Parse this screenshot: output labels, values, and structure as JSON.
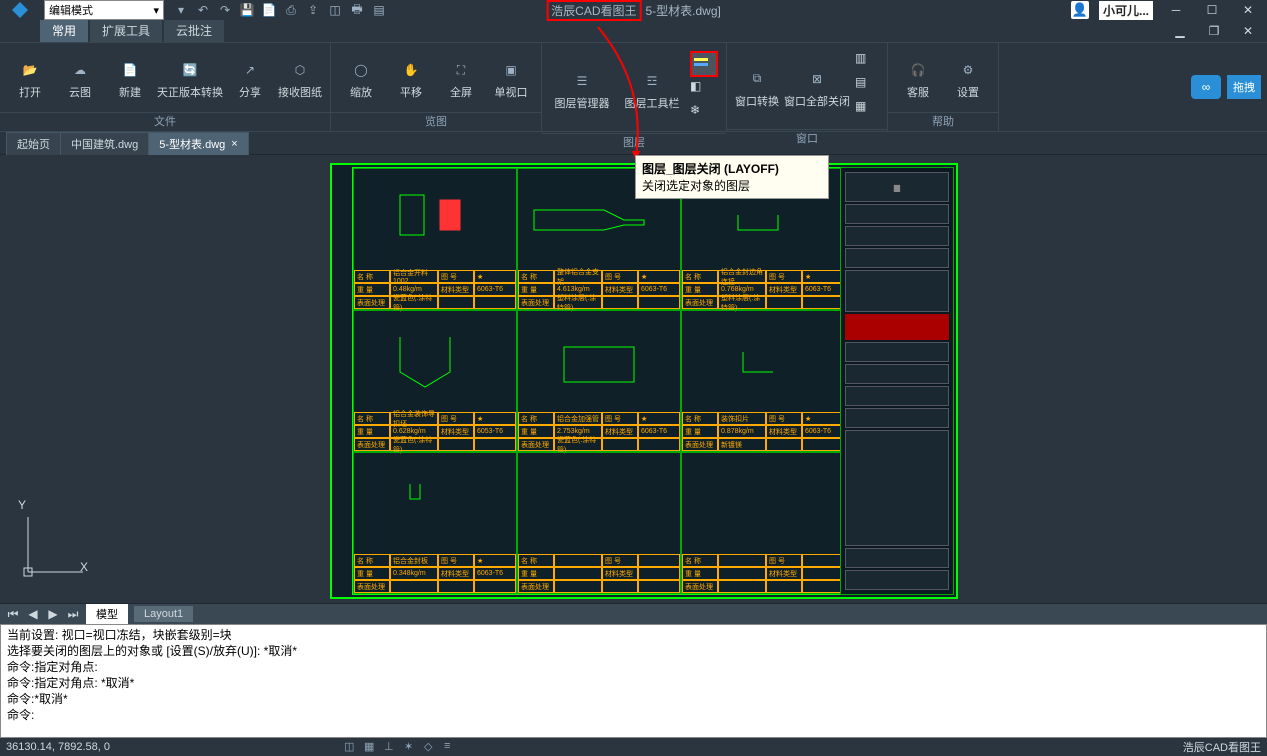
{
  "titlebar": {
    "mode": "编辑模式",
    "app": "浩辰CAD看图王",
    "doc": "5-型材表.dwg]",
    "user": "小可儿..."
  },
  "tabs": {
    "t1": "常用",
    "t2": "扩展工具",
    "t3": "云批注"
  },
  "ribbon": {
    "file": {
      "label": "文件",
      "open": "打开",
      "cloud": "云图",
      "new": "新建",
      "convert": "天正版本转换",
      "share": "分享",
      "receive": "接收图纸"
    },
    "view": {
      "label": "览图",
      "zoom": "缩放",
      "pan": "平移",
      "full": "全屏",
      "single": "单视口"
    },
    "layer": {
      "label": "图层",
      "mgr": "图层管理器",
      "tool": "图层工具栏"
    },
    "window": {
      "label": "窗口",
      "switch": "窗口转换",
      "closeall": "窗口全部关闭"
    },
    "help": {
      "label": "帮助",
      "service": "客服",
      "settings": "设置"
    },
    "pull": "拖拽"
  },
  "doctabs": {
    "t1": "起始页",
    "t2": "中国建筑.dwg",
    "t3": "5-型材表.dwg"
  },
  "tooltip": {
    "title": "图层_图层关闭 (LAYOFF)",
    "body": "关闭选定对象的图层"
  },
  "ucs": {
    "x": "X",
    "y": "Y"
  },
  "layouts": {
    "model": "模型",
    "l1": "Layout1"
  },
  "cmd": {
    "l1": "当前设置: 视口=视口冻结，块嵌套级别=块",
    "l2": "选择要关闭的图层上的对象或 [设置(S)/放弃(U)]: *取消*",
    "l3": "命令:指定对角点:",
    "l4": "命令:指定对角点: *取消*",
    "l5": "命令:*取消*",
    "l6": "命令:"
  },
  "status": {
    "coords": "36130.14, 7892.58, 0",
    "brand": "浩辰CAD看图王"
  },
  "meta": {
    "r1c1": {
      "a": "铝合金开料1002",
      "b": "0.48kg/m",
      "c": "材料类型",
      "d": "6063-T6",
      "e": "表面处理",
      "f": "瓷蓝色(:涂特管)"
    },
    "r1c2": {
      "a": "整体铝合金支架",
      "b": "4.613kg/m",
      "c": "材料类型",
      "d": "6063-T6",
      "e": "表面处理",
      "f": "塑料涂层(:涂特管)"
    },
    "r1c3": {
      "a": "铝合金封边角连接",
      "b": "0.768kg/m",
      "c": "材料类型",
      "d": "6063-T6",
      "e": "表面处理",
      "f": "塑料涂层(:涂特管)"
    },
    "r2c1": {
      "a": "铝合金装饰导扣坯",
      "b": "0.628kg/m",
      "c": "材料类型",
      "d": "6053-T6",
      "e": "表面处理",
      "f": "瓷蓝色(:涂特管)"
    },
    "r2c2": {
      "a": "铝合金加强管",
      "b": "2.753kg/m",
      "c": "材料类型",
      "d": "6063-T6",
      "e": "表面处理",
      "f": "瓷蓝色(:涂特管)"
    },
    "r2c3": {
      "a": "装饰扣片",
      "b": "0.878kg/m",
      "c": "材料类型",
      "d": "6063-T6",
      "e": "表面处理",
      "f": "新镀镁"
    },
    "r3c1": {
      "a": "铝合金封板",
      "b": "0.348kg/m",
      "c": "材料类型",
      "d": "6063-T6",
      "e": "表面处理",
      "f": ""
    },
    "lbl": {
      "name": "名  称",
      "weight": "重  量",
      "spec": "图  号"
    }
  }
}
